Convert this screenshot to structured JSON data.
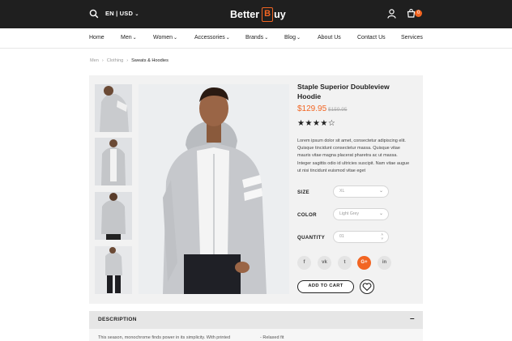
{
  "header": {
    "language_currency": "EN | USD",
    "logo_prefix": "Better ",
    "logo_letter": "B",
    "logo_suffix": "uy",
    "cart_count": "0"
  },
  "nav": {
    "items": [
      {
        "label": "Home",
        "dropdown": false
      },
      {
        "label": "Men",
        "dropdown": true
      },
      {
        "label": "Women",
        "dropdown": true
      },
      {
        "label": "Accessories",
        "dropdown": true
      },
      {
        "label": "Brands",
        "dropdown": true
      },
      {
        "label": "Blog",
        "dropdown": true
      },
      {
        "label": "About Us",
        "dropdown": false
      },
      {
        "label": "Contact Us",
        "dropdown": false
      },
      {
        "label": "Services",
        "dropdown": false
      }
    ]
  },
  "breadcrumb": [
    "Men",
    "Clothing",
    "Sweats & Hoodies"
  ],
  "product": {
    "title": "Staple Superior Doubleview Hoodie",
    "price": "$129.95",
    "old_price": "$159.95",
    "rating": 4,
    "rating_max": 5,
    "description": "Lorem ipsum dolor sit amet, consectetur adipiscing elit. Quisque tincidunt consectetur massa. Quisque vitae mauris vitae magna placerat pharetra ac ut massa. Integer sagittis odio id ultricies suscipit. Nam vitae augue ut nisi tincidunt euismod vitae eget",
    "size_label": "SIZE",
    "size_value": "XL",
    "color_label": "COLOR",
    "color_value": "Light Grey",
    "quantity_label": "QUANTITY",
    "quantity_value": "01",
    "add_to_cart": "ADD TO CART"
  },
  "social": [
    {
      "name": "facebook",
      "glyph": "f"
    },
    {
      "name": "vk",
      "glyph": "vk"
    },
    {
      "name": "twitter",
      "glyph": "t"
    },
    {
      "name": "google-plus",
      "glyph": "G+"
    },
    {
      "name": "linkedin",
      "glyph": "in"
    }
  ],
  "description_section": {
    "label": "DESCRIPTION",
    "toggle": "–",
    "text": "This season, monochrome finds power in its simplicity. With printed",
    "feature": "- Relaxed fit"
  },
  "colors": {
    "accent": "#f26522",
    "topbar": "#1f1f1f",
    "card_bg": "#f2f2f2"
  }
}
